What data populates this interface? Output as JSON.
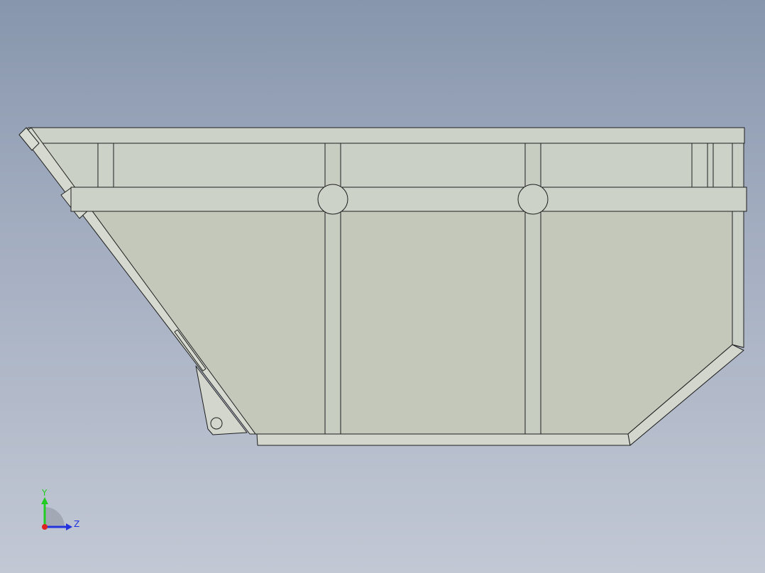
{
  "viewport": {
    "background_top": "#8796ad",
    "background_bottom": "#c2c8d4"
  },
  "model": {
    "face_color": "#c3c8bb",
    "top_face_color": "#cdd2c8",
    "edge_color": "#1e1e1e"
  },
  "triad": {
    "y_label": "Y",
    "z_label": "Z",
    "y_color": "#22cc22",
    "z_color": "#2233dd",
    "x_color": "#dd2222"
  }
}
